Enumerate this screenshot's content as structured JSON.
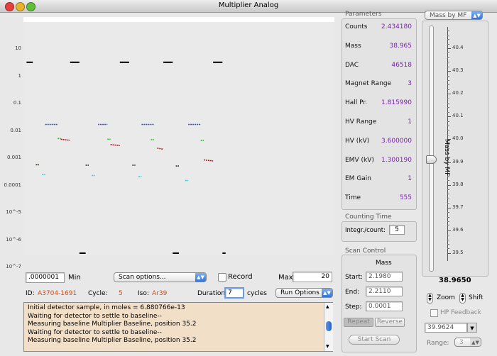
{
  "window": {
    "title": "Multiplier Analog"
  },
  "plot": {
    "y_tick_labels": [
      "10",
      "1",
      "0.1",
      "0.01",
      "0.001",
      "0.0001",
      "10^-5",
      "10^-6",
      "10^-7"
    ]
  },
  "chart_data": {
    "type": "scatter",
    "y_scale": "log",
    "ylim": [
      1e-07,
      10
    ],
    "xlim": [
      0,
      1
    ],
    "series": [
      {
        "color": "#000000",
        "x": [
          [
            0.01,
            0.03
          ],
          [
            0.15,
            0.18
          ],
          [
            0.31,
            0.34
          ],
          [
            0.45,
            0.48
          ],
          [
            0.61,
            0.64
          ]
        ],
        "y": [
          3,
          3,
          3,
          3,
          3
        ]
      },
      {
        "color": "#2a4fd6",
        "x": [
          [
            0.07,
            0.11
          ],
          [
            0.24,
            0.27
          ],
          [
            0.38,
            0.42
          ],
          [
            0.53,
            0.57
          ]
        ],
        "y": [
          0.011,
          0.011,
          0.011,
          0.011
        ]
      },
      {
        "color": "#2fbf2f",
        "x": [
          [
            0.11,
            0.12
          ],
          [
            0.27,
            0.28
          ],
          [
            0.41,
            0.42
          ],
          [
            0.57,
            0.58
          ]
        ],
        "y": [
          0.0031,
          0.0029,
          0.0028,
          0.0026
        ]
      },
      {
        "color": "#b01a1a",
        "x": [
          [
            0.12,
            0.15
          ],
          [
            0.28,
            0.31
          ],
          [
            0.43,
            0.45
          ],
          [
            0.58,
            0.61
          ]
        ],
        "y": [
          0.0029,
          0.0018,
          0.0013,
          0.00045
        ]
      },
      {
        "color": "#3a2a1a",
        "x": [
          [
            0.04,
            0.05
          ],
          [
            0.2,
            0.21
          ],
          [
            0.35,
            0.36
          ],
          [
            0.49,
            0.5
          ]
        ],
        "y": [
          0.00029,
          0.00028,
          0.00028,
          0.00026
        ]
      },
      {
        "color": "#36c8d8",
        "x": [
          [
            0.06,
            0.07
          ],
          [
            0.22,
            0.23
          ],
          [
            0.37,
            0.38
          ],
          [
            0.52,
            0.53
          ]
        ],
        "y": [
          0.00012,
          0.00011,
          0.0001,
          7e-05
        ]
      }
    ]
  },
  "parameters": {
    "title": "Parameters",
    "rows": [
      {
        "label": "Counts",
        "value": "2.434180"
      },
      {
        "label": "Mass",
        "value": "38.965"
      },
      {
        "label": "DAC",
        "value": "46518"
      },
      {
        "label": "Magnet Range",
        "value": "3"
      },
      {
        "label": "Hall Pr.",
        "value": "1.815990"
      },
      {
        "label": "HV Range",
        "value": "1"
      },
      {
        "label": "HV (kV)",
        "value": "3.600000"
      },
      {
        "label": "EMV (kV)",
        "value": "1.300190"
      },
      {
        "label": "EM Gain",
        "value": "1"
      },
      {
        "label": "Time",
        "value": "555"
      }
    ]
  },
  "counting": {
    "title": "Counting Time",
    "label": "Integr./count:",
    "value": "5"
  },
  "scan": {
    "title": "Scan Control",
    "subtitle": "Mass",
    "start_label": "Start:",
    "start": "2.1980",
    "end_label": "End:",
    "end": "2.2110",
    "step_label": "Step:",
    "step": "0.0001",
    "repeat": "Repeat",
    "reverse": "Reverse",
    "start_scan": "Start Scan"
  },
  "right": {
    "popup": "Mass by MF",
    "slider_ticks": [
      "40.4",
      "40.3",
      "40.2",
      "40.1",
      "40.0",
      "39.9",
      "39.8",
      "39.7",
      "39.6",
      "39.5"
    ],
    "vertical_label": "Mass by MF",
    "slider_value_fraction": 0.545,
    "readout": "38.9650",
    "zoom": "Zoom",
    "shift": "Shift",
    "hp_feedback": "HP Feedback",
    "combo": "39.9624",
    "range_label": "Range:",
    "range_value": "3"
  },
  "controls": {
    "min_value": ".0000001",
    "min_label": "Min",
    "scan_options": "Scan options...",
    "record": "Record",
    "max_label": "Max",
    "max_value": "20",
    "id_label": "ID:",
    "id_value": "A3704-1691",
    "cycle_label": "Cycle:",
    "cycle_value": "5",
    "iso_label": "Iso:",
    "iso_value": "Ar39",
    "duration_label": "Duration",
    "duration_value": "7",
    "cycles_label": "cycles",
    "run_options": "Run Options"
  },
  "log": {
    "lines": [
      "Initial detector sample, in moles = 6.880766e-13",
      "Waiting for detector to settle to baseline--",
      "Measuring baseline Multiplier Baseline, position 35.2",
      "Waiting for detector to settle to baseline--",
      "Measuring baseline Multiplier Baseline, position 35.2"
    ]
  }
}
